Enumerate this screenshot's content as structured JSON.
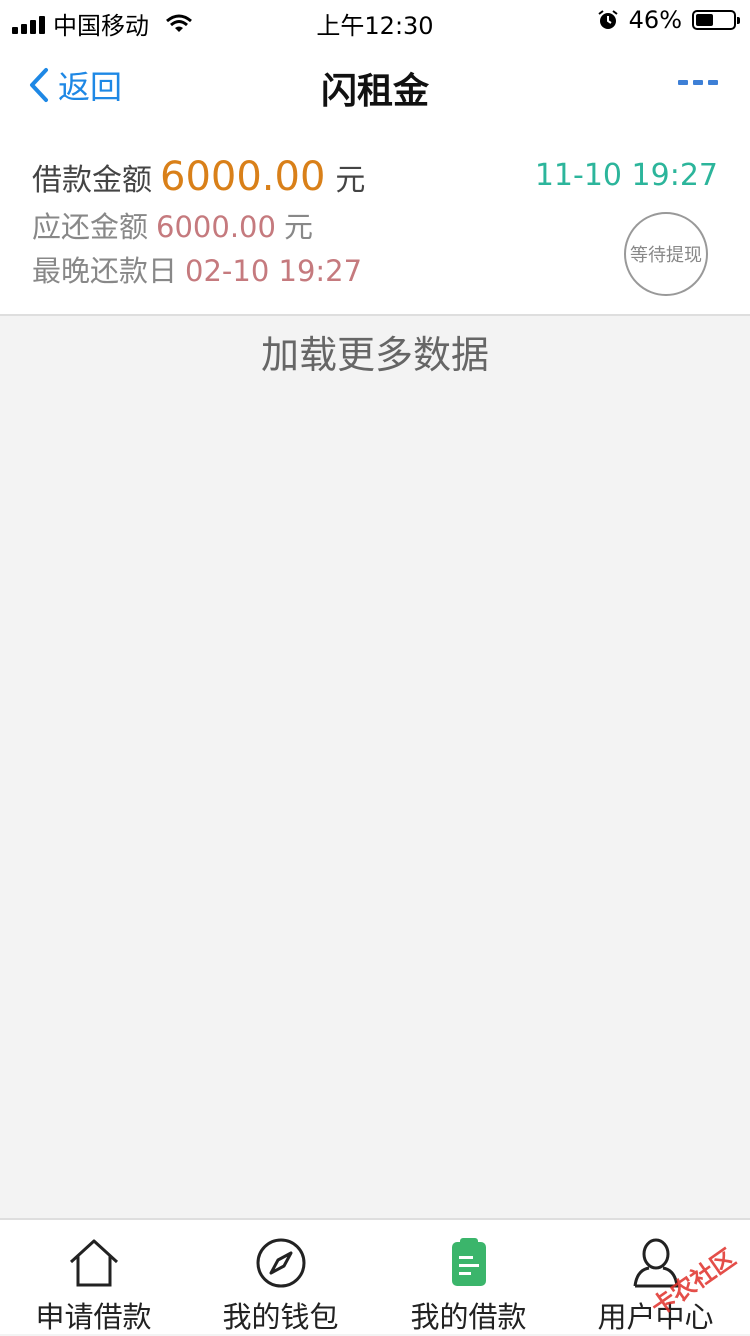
{
  "status_bar": {
    "carrier": "中国移动",
    "time": "上午12:30",
    "battery_text": "46%",
    "battery_level": 0.46
  },
  "nav": {
    "back_label": "返回",
    "title": "闪租金"
  },
  "loan": {
    "borrow_label": "借款金额",
    "borrow_amount": "6000.00",
    "currency": "元",
    "repay_label": "应还金额",
    "repay_amount": "6000.00",
    "repay_currency": "元",
    "due_label": "最晚还款日",
    "due_date": "02-10 19:27",
    "created_time": "11-10 19:27",
    "status": "等待提现"
  },
  "list": {
    "load_more": "加载更多数据"
  },
  "tabs": [
    {
      "label": "申请借款",
      "icon": "home-icon"
    },
    {
      "label": "我的钱包",
      "icon": "compass-icon"
    },
    {
      "label": "我的借款",
      "icon": "clipboard-icon",
      "active": true
    },
    {
      "label": "用户中心",
      "icon": "user-icon"
    }
  ],
  "watermark": "卡农社区",
  "colors": {
    "accent_blue": "#1e88e5",
    "amount_orange": "#d98019",
    "repay_red": "#c57a7e",
    "time_green": "#2cb59b",
    "active_tab_green": "#3bb56b"
  }
}
